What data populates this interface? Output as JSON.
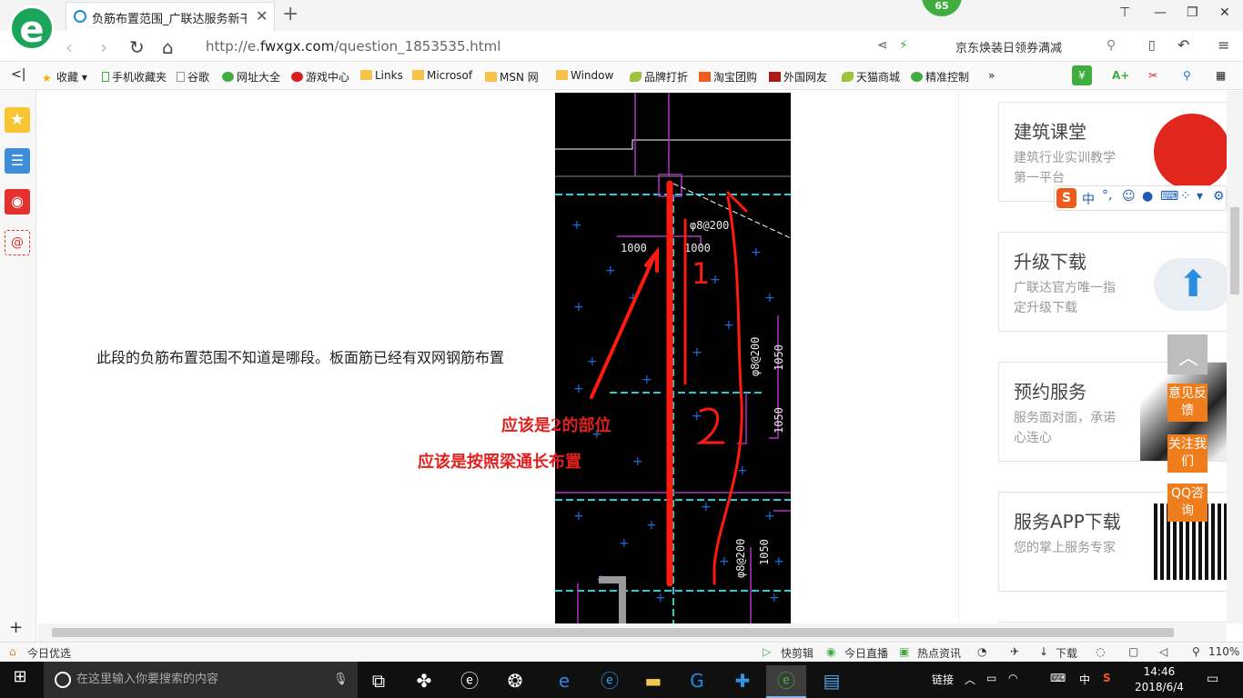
{
  "browser": {
    "tab_title": "负筋布置范围_广联达服务新干线",
    "notification_count": "65",
    "url_prefix": "http://e.",
    "url_domain": "fwxgx.com",
    "url_path": "/question_1853535.html",
    "search_suggestion": "京东焕装日领券满减",
    "zoom": "110%"
  },
  "favorites": [
    {
      "label": "收藏",
      "icon": "star-icon"
    },
    {
      "label": "手机收藏夹",
      "icon": "phone-icon"
    },
    {
      "label": "谷歌",
      "icon": "page-icon"
    },
    {
      "label": "网址大全",
      "icon": "globe-icon"
    },
    {
      "label": "游戏中心",
      "icon": "game-icon"
    },
    {
      "label": "Links",
      "icon": "folder-icon"
    },
    {
      "label": "Microsof",
      "icon": "folder-icon"
    },
    {
      "label": "MSN 网",
      "icon": "folder-icon"
    },
    {
      "label": "Window",
      "icon": "folder-icon"
    },
    {
      "label": "品牌打折",
      "icon": "leaf-icon"
    },
    {
      "label": "淘宝团购",
      "icon": "taobao-icon"
    },
    {
      "label": "外国网友",
      "icon": "flag-icon"
    },
    {
      "label": "天猫商城",
      "icon": "leaf-icon"
    },
    {
      "label": "精准控制",
      "icon": "wechat-icon"
    }
  ],
  "question_text": "此段的负筋布置范围不知道是哪段。板面筋已经有双网钢筋布置",
  "drawing": {
    "dim_1": "1000",
    "dim_2": "1000",
    "rebar_1": "φ8@200",
    "rebar_2": "φ8@200",
    "rebar_3": "φ8@200",
    "len_1": "1050",
    "len_2": "1050",
    "len_3": "1050",
    "mark_1": "1",
    "mark_2": "2",
    "answer_1": "应该是2的部位",
    "answer_2": "应该是按照梁通长布置"
  },
  "sidebar_cards": [
    {
      "title": "建筑课堂",
      "desc": "建筑行业实训教学第一平台"
    },
    {
      "title": "升级下载",
      "desc": "广联达官方唯一指定升级下载"
    },
    {
      "title": "预约服务",
      "desc": "服务面对面，承诺心连心"
    },
    {
      "title": "服务APP下载",
      "desc": "您的掌上服务专家"
    }
  ],
  "float_buttons": [
    "意见反馈",
    "关注我们",
    "QQ咨询"
  ],
  "ime": {
    "lang": "中"
  },
  "status": {
    "today": "今日优选",
    "quick_edit": "快剪辑",
    "live": "今日直播",
    "hot": "热点资讯",
    "download": "下载"
  },
  "taskbar": {
    "search_placeholder": "在这里输入你要搜索的内容",
    "link_label": "链接",
    "ime_label": "中",
    "time": "14:46",
    "date": "2018/6/4"
  }
}
